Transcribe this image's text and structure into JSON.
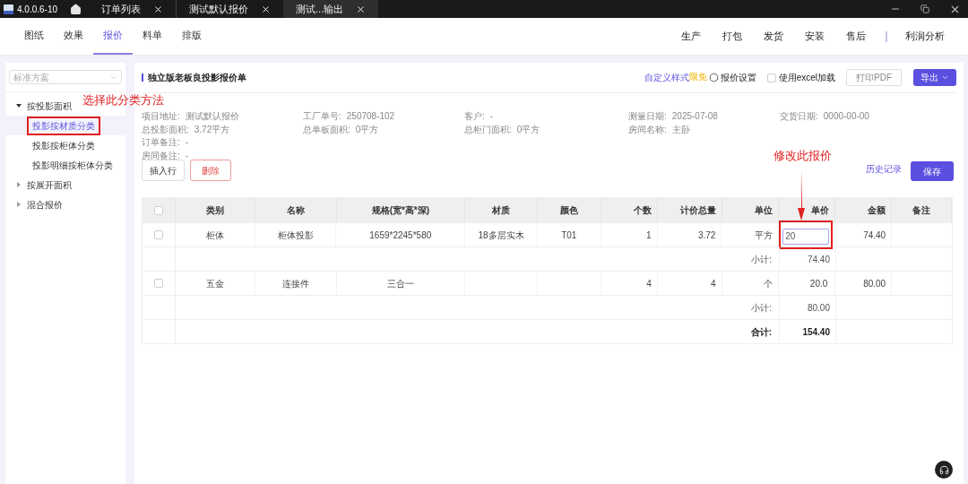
{
  "titlebar": {
    "version": "4.0.0.6-10",
    "tabs": [
      {
        "label": "订单列表",
        "selected": false
      },
      {
        "label": "测试默认报价",
        "selected": false
      },
      {
        "label": "测试...输出",
        "selected": true
      }
    ]
  },
  "nav": {
    "left": [
      {
        "label": "图纸",
        "selected": false
      },
      {
        "label": "效果",
        "selected": false
      },
      {
        "label": "报价",
        "selected": true
      },
      {
        "label": "料单",
        "selected": false
      },
      {
        "label": "排版",
        "selected": false
      }
    ],
    "right": [
      "生产",
      "打包",
      "发货",
      "安装",
      "售后"
    ],
    "extra": "利润分析"
  },
  "sidebar": {
    "scheme": {
      "placeholder": "标准方案"
    },
    "tree": [
      {
        "label": "按投影面积",
        "expanded": true,
        "children": [
          {
            "label": "投影按材质分类",
            "selected": true,
            "annotated": true
          },
          {
            "label": "投影按柜体分类",
            "selected": false,
            "annotated": false
          },
          {
            "label": "投影明细按柜体分类",
            "selected": false,
            "annotated": false
          }
        ]
      },
      {
        "label": "按展开面积",
        "expanded": false
      },
      {
        "label": "混合报价",
        "expanded": false
      }
    ]
  },
  "header": {
    "title": "独立版老板良投影报价单",
    "custom_style": "自定义样式",
    "badge": "限免",
    "settings": "报价设置",
    "excel": {
      "label": "使用excel加载",
      "checked": false
    },
    "print": "打印PDF",
    "export": "导出"
  },
  "info_rows": [
    [
      {
        "label": "项目地址:",
        "value": "测试默认报价"
      },
      {
        "label": "工厂单号:",
        "value": "250708-102"
      },
      {
        "label": "客户:",
        "value": "-"
      },
      {
        "label": "测量日期:",
        "value": "2025-07-08"
      },
      {
        "label": "交货日期:",
        "value": "0000-00-00"
      }
    ],
    [
      {
        "label": "总投影面积:",
        "value": "3.72平方"
      },
      {
        "label": "总单板面积:",
        "value": "0平方"
      },
      {
        "label": "总柜门面积:",
        "value": "0平方"
      },
      {
        "label": "房间名称:",
        "value": "主卧"
      }
    ],
    [
      {
        "label": "订单备注:",
        "value": "-"
      }
    ],
    [
      {
        "label": "房间备注:",
        "value": "-"
      }
    ]
  ],
  "actions": {
    "insert": "插入行",
    "delete": "删除",
    "history": "历史记录",
    "save": "保存"
  },
  "annotations": {
    "sidebar_note": "选择此分类方法",
    "price_note": "修改此报价"
  },
  "table": {
    "select_all": {
      "checked": false
    },
    "columns": [
      "类别",
      "名称",
      "规格(宽*高*深)",
      "材质",
      "颜色",
      "个数",
      "计价总量",
      "单位",
      "单价",
      "金额",
      "备注"
    ],
    "rows": [
      {
        "kind": "item",
        "checked": false,
        "cells": [
          "柜体",
          "柜体投影",
          "1659*2245*580",
          "18多层实木",
          "T01",
          "1",
          "3.72",
          "平方"
        ],
        "unit_price": "20",
        "editing": true,
        "annotated": true,
        "amount": "74.40"
      },
      {
        "kind": "subtotal",
        "label": "小计:",
        "amount": "74.40"
      },
      {
        "kind": "item",
        "checked": false,
        "cells": [
          "五金",
          "连接件",
          "三合一",
          "",
          "",
          "4",
          "4",
          "个"
        ],
        "unit_price": "20.0",
        "editing": false,
        "annotated": false,
        "amount": "80.00"
      },
      {
        "kind": "subtotal",
        "label": "小计:",
        "amount": "80.00"
      },
      {
        "kind": "total",
        "label": "合计:",
        "amount": "154.40"
      }
    ]
  }
}
